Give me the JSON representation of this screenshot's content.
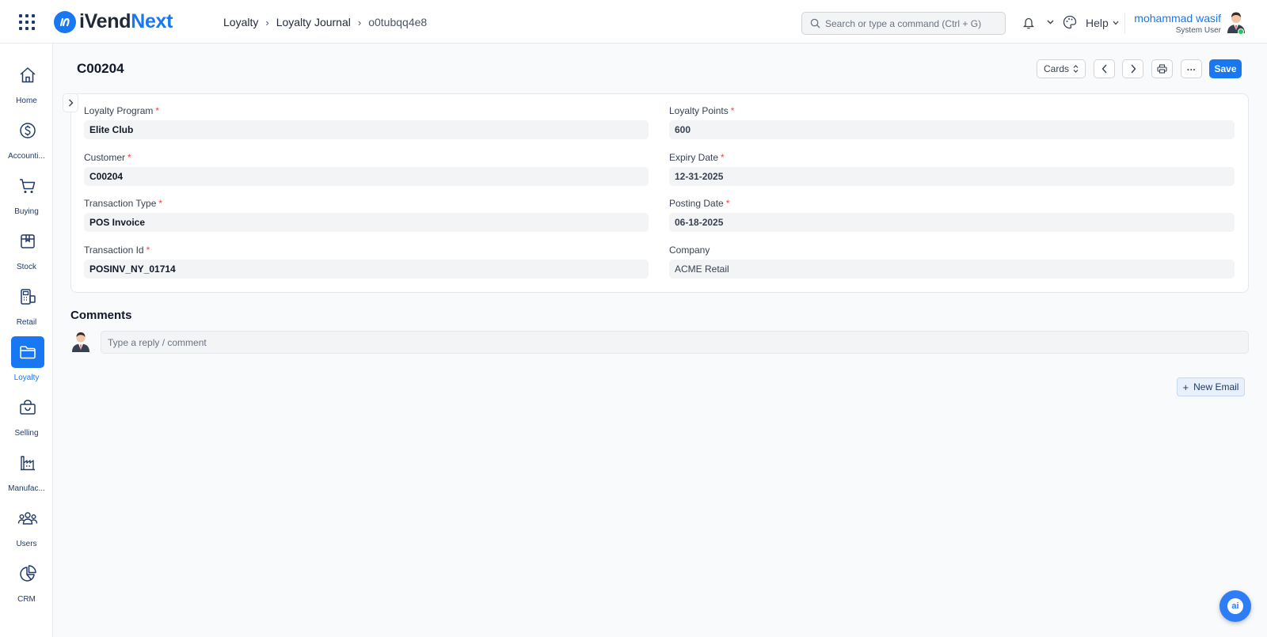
{
  "app": {
    "logo_part1": "iVend",
    "logo_part2": "Next",
    "brand_color": "#1877f2"
  },
  "breadcrumb": {
    "items": [
      "Loyalty",
      "Loyalty Journal",
      "o0tubqq4e8"
    ]
  },
  "search": {
    "placeholder": "Search or type a command (Ctrl + G)"
  },
  "header_right": {
    "help_label": "Help",
    "user_name": "mohammad wasif",
    "user_role": "System User"
  },
  "sidebar": {
    "items": [
      {
        "label": "Home",
        "icon": "home-icon"
      },
      {
        "label": "Accounti...",
        "icon": "dollar-icon"
      },
      {
        "label": "Buying",
        "icon": "cart-icon"
      },
      {
        "label": "Stock",
        "icon": "box-icon"
      },
      {
        "label": "Retail",
        "icon": "pos-icon"
      },
      {
        "label": "Loyalty",
        "icon": "folder-icon",
        "active": true
      },
      {
        "label": "Selling",
        "icon": "bag-icon"
      },
      {
        "label": "Manufac...",
        "icon": "factory-icon"
      },
      {
        "label": "Users",
        "icon": "users-icon"
      },
      {
        "label": "CRM",
        "icon": "pie-chart-icon"
      }
    ]
  },
  "doc": {
    "title": "C00204",
    "view_select": "Cards",
    "save_label": "Save",
    "more_label": "..."
  },
  "form": {
    "left": [
      {
        "label": "Loyalty Program",
        "required": "*",
        "value": "Elite Club"
      },
      {
        "label": "Customer",
        "required": "*",
        "value": "C00204"
      },
      {
        "label": "Transaction Type",
        "required": "*",
        "value": "POS Invoice"
      },
      {
        "label": "Transaction Id",
        "required": "*",
        "value": "POSINV_NY_01714"
      }
    ],
    "right": [
      {
        "label": "Loyalty Points",
        "required": "*",
        "value": "600"
      },
      {
        "label": "Expiry Date",
        "required": "*",
        "value": "12-31-2025"
      },
      {
        "label": "Posting Date",
        "required": "*",
        "value": "06-18-2025"
      },
      {
        "label": "Company",
        "required": "",
        "value": "ACME Retail"
      }
    ]
  },
  "comments": {
    "title": "Comments",
    "placeholder": "Type a reply / comment"
  },
  "actions": {
    "new_email": "New Email",
    "new_email_plus": "+"
  },
  "ai_button": {
    "label": "ai"
  }
}
